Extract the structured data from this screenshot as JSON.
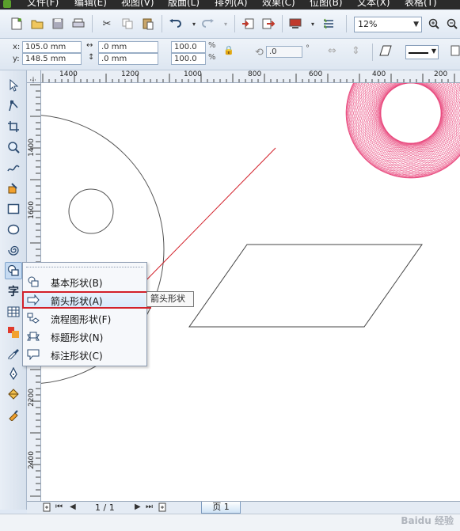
{
  "menubar": {
    "items": [
      {
        "label": "文件(F)"
      },
      {
        "label": "编辑(E)"
      },
      {
        "label": "视图(V)"
      },
      {
        "label": "版面(L)"
      },
      {
        "label": "排列(A)"
      },
      {
        "label": "效果(C)"
      },
      {
        "label": "位图(B)"
      },
      {
        "label": "文本(X)"
      },
      {
        "label": "表格(T)"
      }
    ]
  },
  "toolbar": {
    "zoom_value": "12%"
  },
  "propbar": {
    "x_label": "x:",
    "y_label": "y:",
    "x_value": "105.0 mm",
    "y_value": "148.5 mm",
    "width_value": ".0 mm",
    "height_value": ".0 mm",
    "scale_w": "100.0",
    "scale_h": "100.0",
    "percent": "%",
    "rotation_value": ".0",
    "degree": "°"
  },
  "ruler_top": {
    "labels": [
      "1400",
      "1200",
      "1000",
      "800",
      "600",
      "400",
      "200"
    ]
  },
  "ruler_left": {
    "labels": [
      "1400",
      "1600",
      "1800",
      "2000",
      "2200",
      "2400"
    ]
  },
  "flyout": {
    "items": [
      {
        "label": "基本形状(B)",
        "icon": "basic-shapes-icon"
      },
      {
        "label": "箭头形状(A)",
        "icon": "arrow-shapes-icon"
      },
      {
        "label": "流程图形状(F)",
        "icon": "flowchart-shapes-icon"
      },
      {
        "label": "标题形状(N)",
        "icon": "banner-shapes-icon"
      },
      {
        "label": "标注形状(C)",
        "icon": "callout-shapes-icon"
      }
    ],
    "tooltip": "箭头形状"
  },
  "pagebar": {
    "page_count": "1 / 1",
    "page_tab": "页 1"
  },
  "watermark": "Baidu 经验",
  "colors": {
    "accent_red": "#d2202a",
    "pink_shape": "#e8457a"
  }
}
